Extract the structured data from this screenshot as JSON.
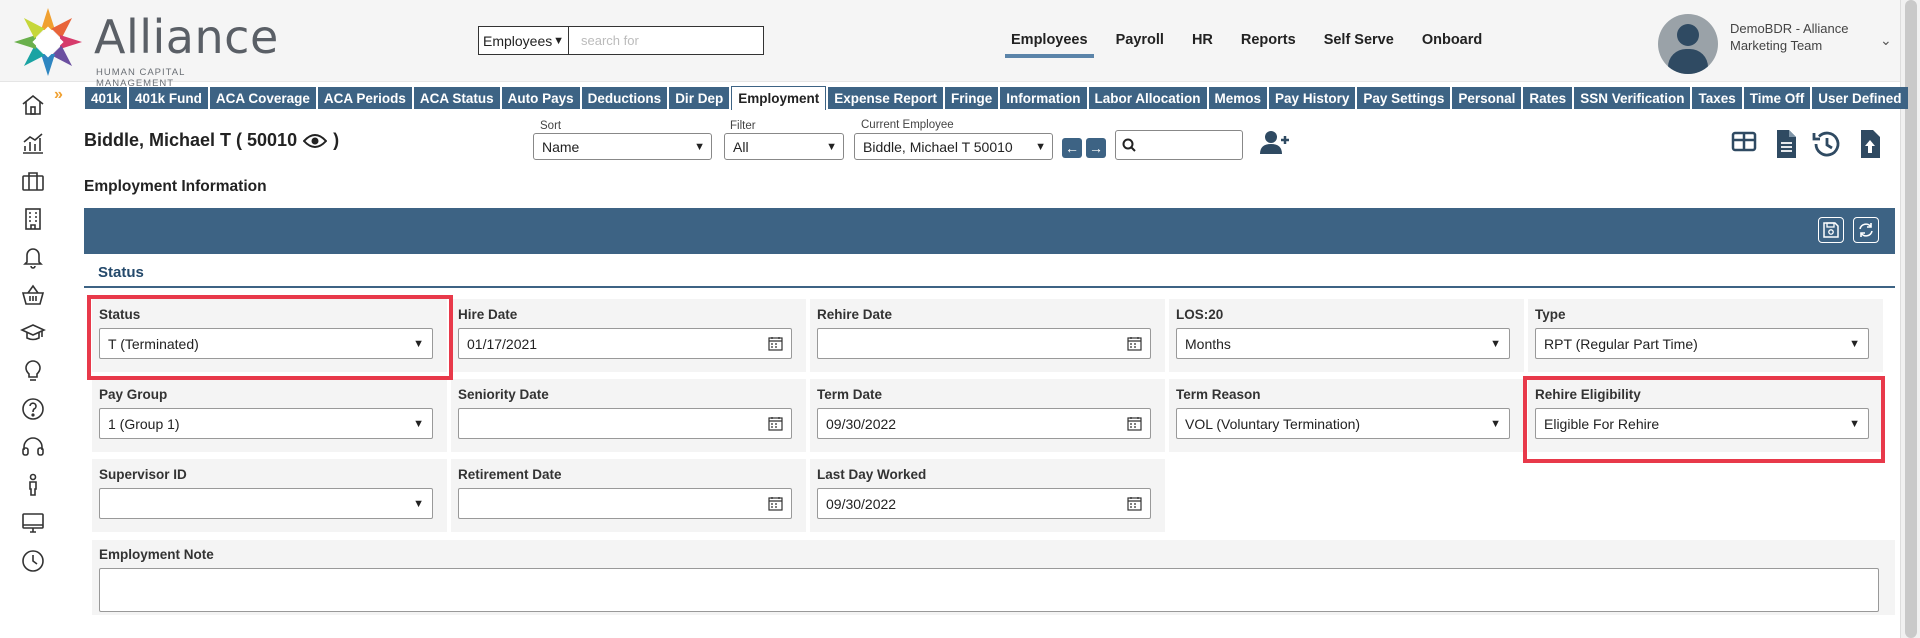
{
  "header": {
    "logo_word": "Alliance",
    "logo_sub": "HUMAN CAPITAL MANAGEMENT",
    "search": {
      "scope": "Employees",
      "placeholder": "search for"
    },
    "nav": [
      "Employees",
      "Payroll",
      "HR",
      "Reports",
      "Self Serve",
      "Onboard"
    ],
    "nav_active": "Employees",
    "user": {
      "line1": "DemoBDR - Alliance",
      "line2": "Marketing Team"
    }
  },
  "sidebar": {
    "icons": [
      "home-icon",
      "chart-icon",
      "briefcase-icon",
      "building-icon",
      "bell-icon",
      "basket-icon",
      "graduation-cap-icon",
      "lightbulb-icon",
      "help-icon",
      "headset-icon",
      "person-icon",
      "monitor-icon",
      "clock-icon"
    ]
  },
  "tabs": [
    "401k",
    "401k Fund",
    "ACA Coverage",
    "ACA Periods",
    "ACA Status",
    "Auto Pays",
    "Deductions",
    "Dir Dep",
    "Employment",
    "Expense Report",
    "Fringe",
    "Information",
    "Labor Allocation",
    "Memos",
    "Pay History",
    "Pay Settings",
    "Personal",
    "Rates",
    "SSN Verification",
    "Taxes",
    "Time Off",
    "User Defined"
  ],
  "tab_active": "Employment",
  "employee": {
    "title": "Biddle, Michael T ( 50010",
    "sort_label": "Sort",
    "sort_value": "Name",
    "filter_label": "Filter",
    "filter_value": "All",
    "current_label": "Current Employee",
    "current_value": "Biddle, Michael T 50010"
  },
  "section": {
    "title": "Employment Information",
    "status_heading": "Status"
  },
  "fields": {
    "status": {
      "label": "Status",
      "value": "T (Terminated)"
    },
    "hire_date": {
      "label": "Hire Date",
      "value": "01/17/2021"
    },
    "rehire_date": {
      "label": "Rehire Date",
      "value": ""
    },
    "los": {
      "label": "LOS:20",
      "value": "Months"
    },
    "type": {
      "label": "Type",
      "value": "RPT (Regular Part Time)"
    },
    "pay_group": {
      "label": "Pay Group",
      "value": "1 (Group 1)"
    },
    "seniority_date": {
      "label": "Seniority Date",
      "value": ""
    },
    "term_date": {
      "label": "Term Date",
      "value": "09/30/2022"
    },
    "term_reason": {
      "label": "Term Reason",
      "value": "VOL (Voluntary Termination)"
    },
    "rehire_eligibility": {
      "label": "Rehire Eligibility",
      "value": "Eligible For Rehire"
    },
    "supervisor_id": {
      "label": "Supervisor ID",
      "value": ""
    },
    "retirement_date": {
      "label": "Retirement Date",
      "value": ""
    },
    "last_day_worked": {
      "label": "Last Day Worked",
      "value": "09/30/2022"
    },
    "employment_note": {
      "label": "Employment Note",
      "value": ""
    }
  },
  "colors": {
    "primary": "#3d6384",
    "highlight": "#e8394a",
    "accent": "#f0a030"
  }
}
